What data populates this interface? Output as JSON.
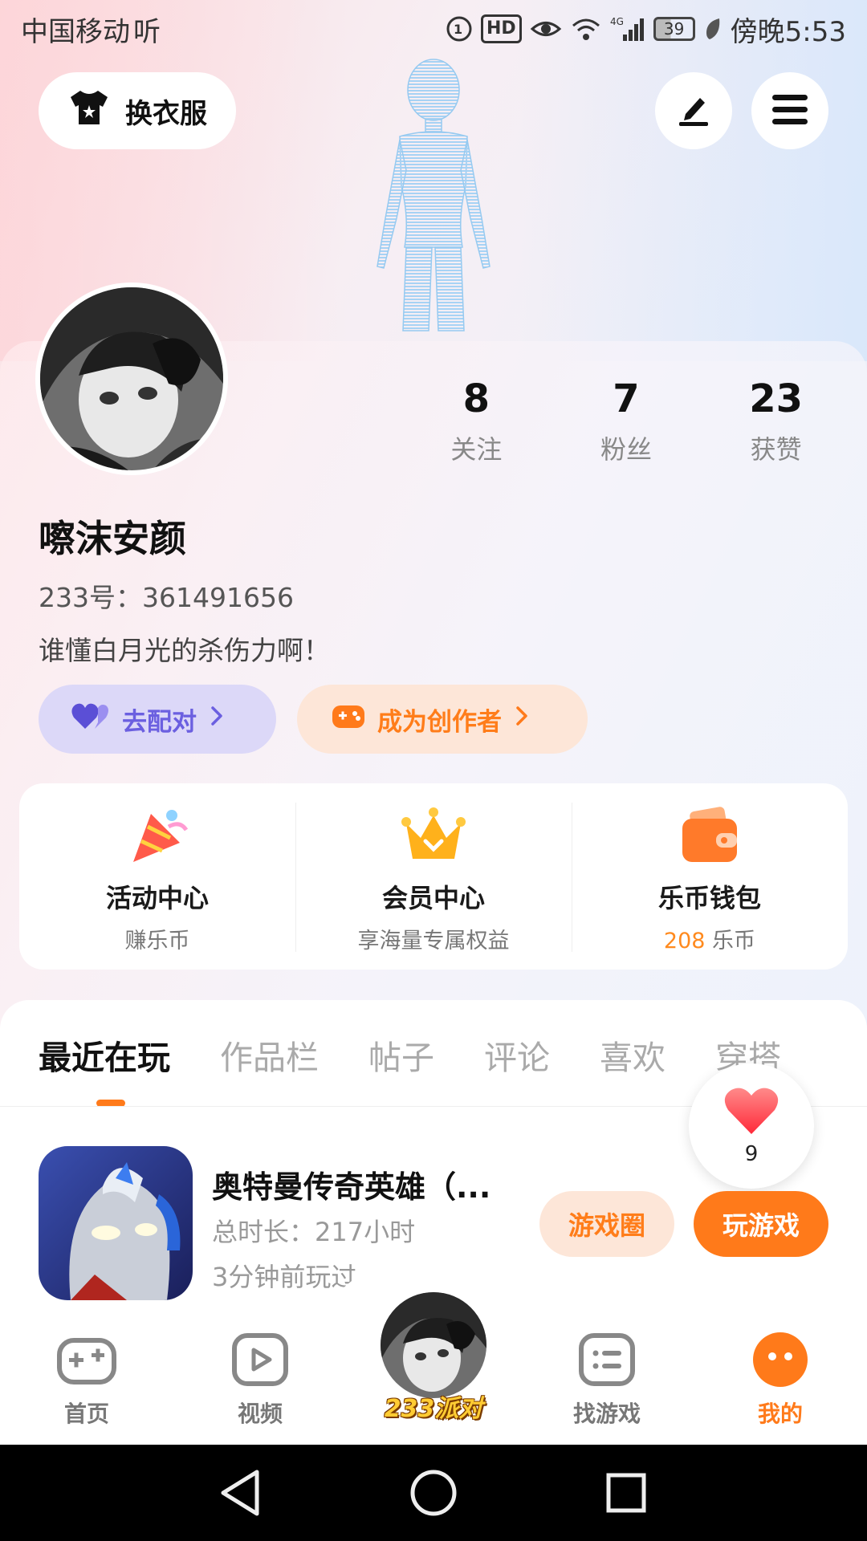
{
  "status_bar": {
    "carrier": "中国移动",
    "carrier_suffix": "听",
    "hd_badge": "HD",
    "network": "4G",
    "battery": "39",
    "time": "傍晚5:53"
  },
  "header": {
    "outfit_button": "换衣服",
    "edit_icon": "pen-icon",
    "menu_icon": "menu-icon"
  },
  "profile": {
    "stats": [
      {
        "value": "8",
        "label": "关注"
      },
      {
        "value": "7",
        "label": "粉丝"
      },
      {
        "value": "23",
        "label": "获赞"
      }
    ],
    "username": "嚓沫安颜",
    "uid": "233号：361491656",
    "bio": "谁懂白月光的杀伤力啊！",
    "match_chip": "去配对",
    "creator_chip": "成为创作者"
  },
  "features": [
    {
      "title": "活动中心",
      "subtitle": "赚乐币",
      "icon": "party-icon"
    },
    {
      "title": "会员中心",
      "subtitle": "享海量专属权益",
      "icon": "crown-icon"
    },
    {
      "title": "乐币钱包",
      "coins": "208",
      "coins_unit": " 乐币",
      "icon": "wallet-icon"
    }
  ],
  "tabs": [
    "最近在玩",
    "作品栏",
    "帖子",
    "评论",
    "喜欢",
    "穿搭"
  ],
  "active_tab": 0,
  "like_fab": {
    "count": "9"
  },
  "recent_game": {
    "name": "奥特曼传奇英雄（...",
    "duration": "总时长：217小时",
    "last_played": "3分钟前玩过",
    "circle_button": "游戏圈",
    "play_button": "玩游戏"
  },
  "bottom_nav": {
    "items": [
      {
        "label": "首页",
        "icon": "gamepad-icon"
      },
      {
        "label": "视频",
        "icon": "video-icon"
      },
      {
        "label": "找游戏",
        "icon": "list-icon"
      },
      {
        "label": "我的",
        "icon": "profile-face-icon"
      }
    ],
    "center_label": "233派对",
    "active": "我的"
  },
  "colors": {
    "accent": "#ff7a1a",
    "match_purple": "#6b5fe0",
    "coins": "#ff8a1e"
  }
}
